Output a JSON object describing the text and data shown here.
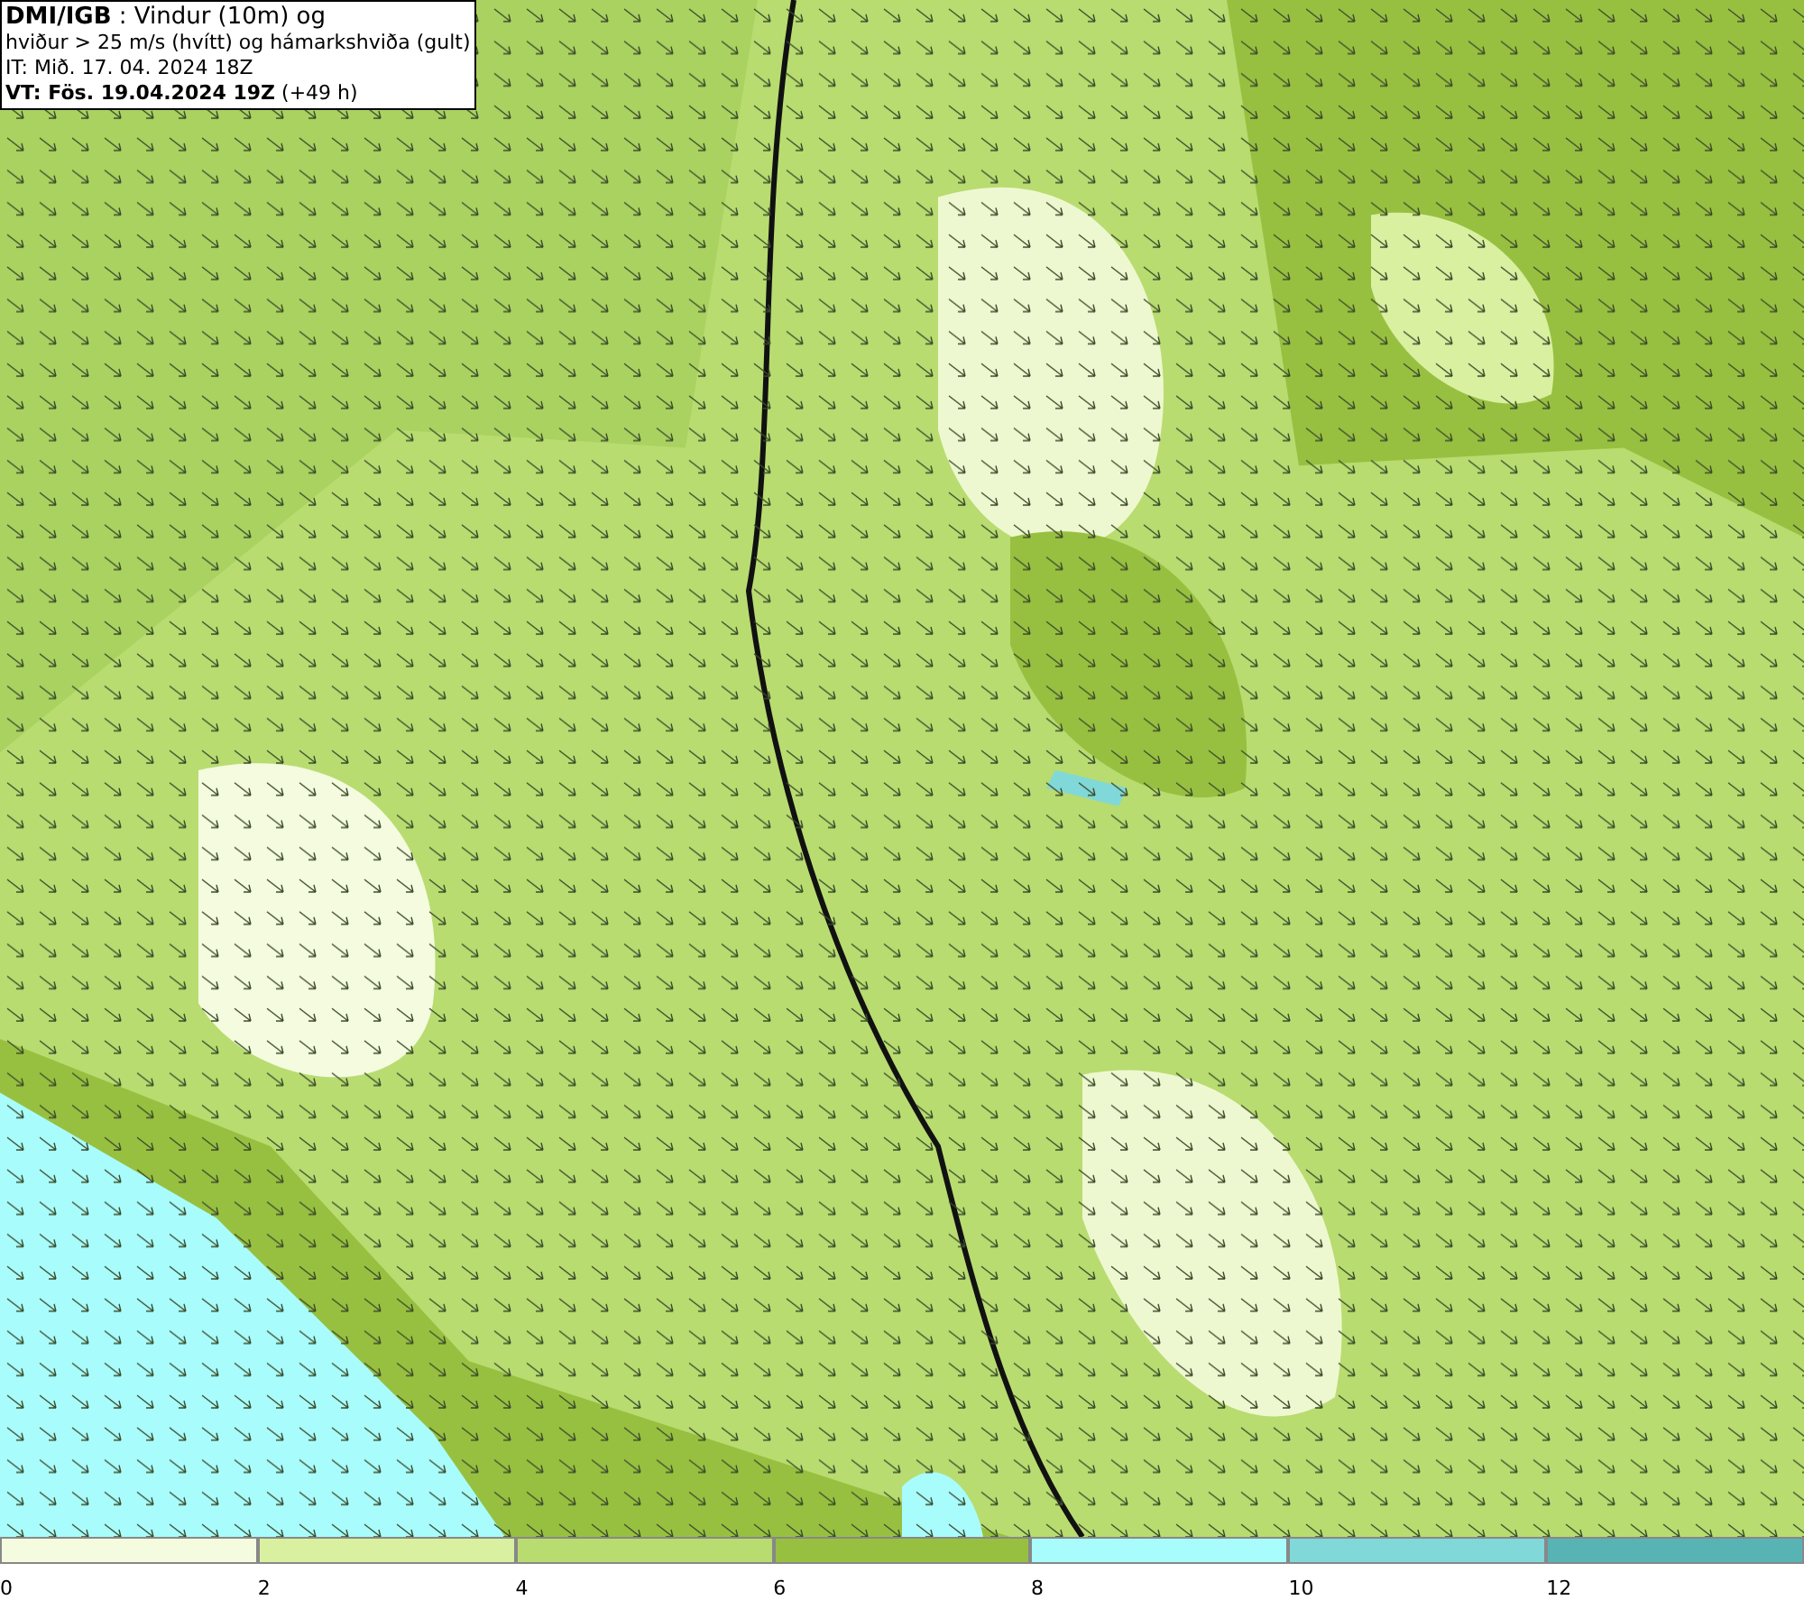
{
  "header": {
    "lines": [
      "**DMI/IGB** : Vindur (10m) og",
      "hviður > 25 m/s (hvítt) og hámarkshviða (gult)",
      "IT: Mið. 17. 04. 2024 18Z",
      "**VT: Fös. 19.04.2024 19Z** (+49 h)"
    ]
  },
  "legend": [
    {
      "label": "0",
      "color": "#f4fbdf"
    },
    {
      "label": "2",
      "color": "#d8f0a0"
    },
    {
      "label": "4",
      "color": "#b8dc70"
    },
    {
      "label": "6",
      "color": "#98c040"
    },
    {
      "label": "8",
      "color": "#a8fcfc"
    },
    {
      "label": "10",
      "color": "#80d8d8"
    },
    {
      "label": "12",
      "color": "#58b4b4"
    }
  ]
}
